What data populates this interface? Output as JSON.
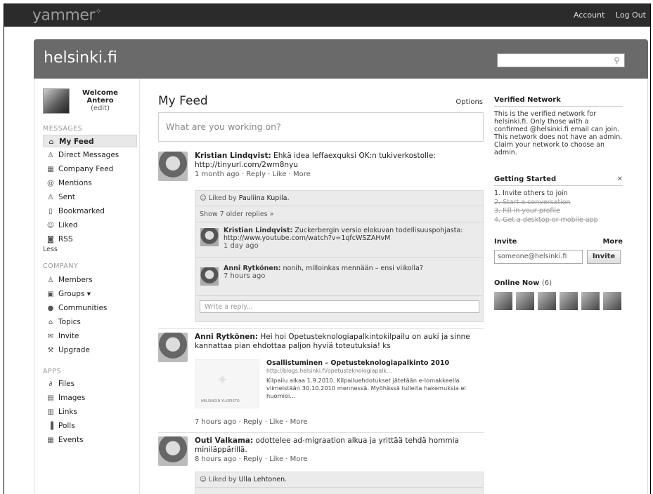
{
  "topbar": {
    "logo": "yammer",
    "logo_mark": "✧",
    "account": "Account",
    "logout": "Log Out"
  },
  "network": {
    "name": "helsinki.fi",
    "search_placeholder": ""
  },
  "user": {
    "welcome": "Welcome",
    "name": "Antero",
    "edit": "(edit)"
  },
  "sidebar": {
    "messages_title": "MESSAGES",
    "messages": [
      {
        "label": "My Feed",
        "icon": "home-icon"
      },
      {
        "label": "Direct Messages",
        "icon": "people-icon"
      },
      {
        "label": "Company Feed",
        "icon": "building-icon"
      },
      {
        "label": "Mentions",
        "icon": "at-icon"
      },
      {
        "label": "Sent",
        "icon": "sent-icon"
      },
      {
        "label": "Bookmarked",
        "icon": "bookmark-icon"
      },
      {
        "label": "Liked",
        "icon": "smile-icon"
      },
      {
        "label": "RSS",
        "icon": "rss-icon"
      }
    ],
    "less": "Less",
    "company_title": "COMPANY",
    "company": [
      {
        "label": "Members",
        "icon": "members-icon"
      },
      {
        "label": "Groups ▾",
        "icon": "groups-icon"
      },
      {
        "label": "Communities",
        "icon": "globe-icon"
      },
      {
        "label": "Topics",
        "icon": "tag-icon"
      },
      {
        "label": "Invite",
        "icon": "envelope-icon"
      },
      {
        "label": "Upgrade",
        "icon": "wrench-icon"
      }
    ],
    "apps_title": "APPS",
    "apps": [
      {
        "label": "Files",
        "icon": "paperclip-icon"
      },
      {
        "label": "Images",
        "icon": "image-icon"
      },
      {
        "label": "Links",
        "icon": "link-icon"
      },
      {
        "label": "Polls",
        "icon": "poll-icon"
      },
      {
        "label": "Events",
        "icon": "calendar-icon"
      }
    ]
  },
  "feed": {
    "title": "My Feed",
    "options": "Options",
    "post_placeholder": "What are you working on?",
    "messages": [
      {
        "author": "Kristian Lindqvist:",
        "text": " Ehkä idea leffaexquksi OK:n tukiverkostolle: http://tinyurl.com/2wm8nyu",
        "meta": "1 month ago · Reply · Like · More",
        "liked_prefix": "Liked by ",
        "liked_by": "Pauliina Kupila.",
        "show_older": "Show 7 older replies »",
        "replies": [
          {
            "author": "Kristian Lindqvist:",
            "text": " Zuckerbergin versio elokuvan todellisuuspohjasta: http://www.youtube.com/watch?v=1qfcWSZAHvM",
            "meta": "1 day ago"
          },
          {
            "author": "Anni Rytkönen:",
            "text": " nonih, milloinkas mennään – ensi viikolla?",
            "meta": "7 hours ago"
          }
        ],
        "reply_placeholder": "Write a reply..."
      },
      {
        "author": "Anni Rytkönen:",
        "text": " Hei hoi Opetusteknologiapalkintokilpailu on auki ja sinne kannattaa pian ehdottaa paljon hyviä toteutuksia! ks",
        "attachment": {
          "title": "Osallistuminen – Opetusteknologiapalkinto 2010",
          "url": "http://blogs.helsinki.fi/opetusteknologiapalk...",
          "desc": "Kilpailu alkaa 1.9.2010. Kilpailuehdotukset jätetään e-lomakkeella viimeistään 30.10.2010 mennessä. Myöhässä tulleita hakemuksia ei huomioi...",
          "thumb_label": "HELSINGIN YLIOPISTO"
        },
        "meta": "7 hours ago · Reply · Like · More"
      },
      {
        "author": "Outi Valkama:",
        "text": " odottelee ad-migraation alkua ja yrittää tehdä hommia miniläppärillä.",
        "meta": "8 hours ago · Reply · Like · More",
        "liked_prefix": "Liked by ",
        "liked_by": "Ulla Lehtonen."
      }
    ]
  },
  "right": {
    "verified_title": "Verified Network",
    "verified_text": "This is the verified network for helsinki.fi. Only those with a confirmed @helsinki.fi email can join. This network does not have an admin. Claim your network to choose an admin.",
    "getting_started_title": "Getting Started",
    "close": "✕",
    "steps": [
      {
        "text": "1.  Invite others to join",
        "done": false
      },
      {
        "text": "2.  Start a conversation",
        "done": true
      },
      {
        "text": "3.  Fill in your profile",
        "done": true
      },
      {
        "text": "4.  Get a desktop or mobile app",
        "done": true
      }
    ],
    "invite_title": "Invite",
    "invite_more": "More",
    "invite_value": "someone@helsinki.fi",
    "invite_button": "Invite",
    "online_title": "Online Now",
    "online_count": "(6)"
  }
}
